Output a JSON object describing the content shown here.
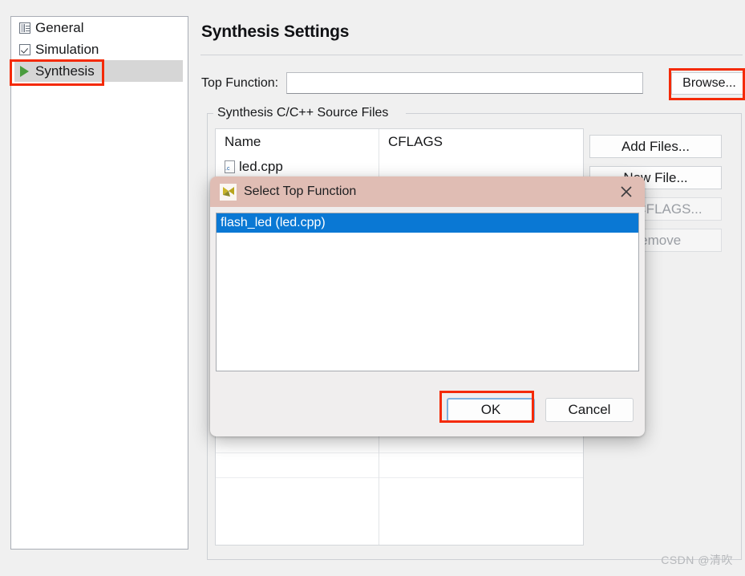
{
  "sidebar": {
    "items": [
      {
        "label": "General",
        "icon": "properties-icon",
        "selected": false
      },
      {
        "label": "Simulation",
        "icon": "checkbox-icon",
        "selected": false
      },
      {
        "label": "Synthesis",
        "icon": "play-triangle-icon",
        "selected": true
      }
    ]
  },
  "main": {
    "title": "Synthesis Settings",
    "top_function": {
      "label": "Top Function:",
      "value": "",
      "placeholder": "",
      "browse_label": "Browse..."
    },
    "group": {
      "legend": "Synthesis C/C++ Source Files",
      "columns": [
        "Name",
        "CFLAGS"
      ],
      "rows": [
        {
          "name": "led.cpp",
          "cflags": "",
          "icon": "c-file-icon"
        }
      ],
      "empty_row_count": 13,
      "buttons": [
        {
          "label": "Add Files...",
          "name": "add-files-button",
          "disabled": false
        },
        {
          "label": "New File...",
          "name": "new-file-button",
          "disabled": false
        },
        {
          "label": "Edit CFLAGS...",
          "name": "edit-cflags-button",
          "disabled": true
        },
        {
          "label": "Remove",
          "name": "remove-button",
          "disabled": true
        }
      ]
    }
  },
  "dialog": {
    "title": "Select Top Function",
    "icon": "vivado-logo-icon",
    "close_label": "×",
    "list": [
      {
        "label": "flash_led (led.cpp)",
        "selected": true
      }
    ],
    "ok_label": "OK",
    "cancel_label": "Cancel"
  },
  "annotations": {
    "color": "#f42a07",
    "targets": [
      "sidebar-item-synthesis",
      "browse-button",
      "dialog-ok-button"
    ]
  },
  "watermark": "CSDN @清吹"
}
